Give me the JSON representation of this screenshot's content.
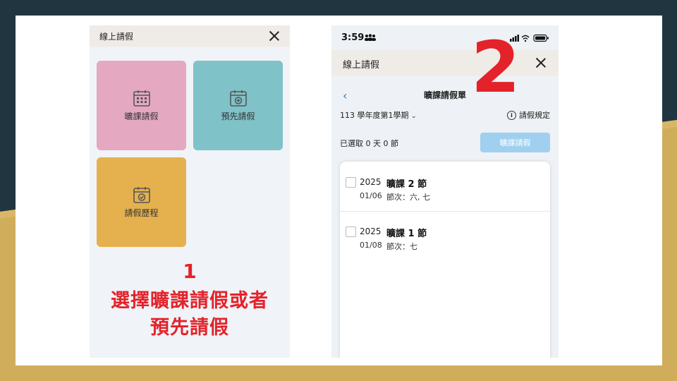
{
  "left_phone": {
    "header_title": "線上請假",
    "tiles": [
      {
        "label": "曠課請假",
        "color": "#e4a9c1"
      },
      {
        "label": "預先請假",
        "color": "#7fc2c8"
      },
      {
        "label": "請假歷程",
        "color": "#e5b14e"
      }
    ],
    "annotation_number": "1",
    "annotation_line1": "選擇曠課請假或者",
    "annotation_line2": "預先請假"
  },
  "right_phone": {
    "status_time": "3:59",
    "header_title": "線上請假",
    "annotation_number": "2",
    "page_title": "曠課請假單",
    "semester": "113 學年度第1學期",
    "rules_label": "請假規定",
    "selected_text": "已選取 0 天 0 節",
    "submit_label": "曠課請假",
    "items": [
      {
        "year": "2025",
        "title": "曠課 2 節",
        "date": "01/06",
        "periods": "節次：六, 七"
      },
      {
        "year": "2025",
        "title": "曠課 1 節",
        "date": "01/08",
        "periods": "節次：七"
      }
    ]
  },
  "colors": {
    "annotation": "#e3222a",
    "link": "#2f74c0",
    "submit_disabled": "#9fd0ef"
  }
}
